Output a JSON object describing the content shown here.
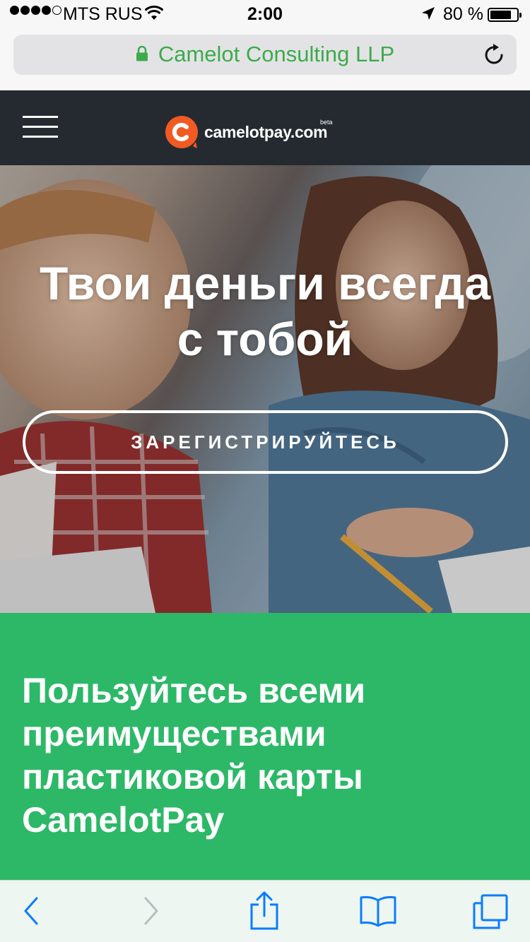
{
  "status_bar": {
    "carrier": "MTS RUS",
    "time": "2:00",
    "battery_percent": "80 %",
    "battery_level": 0.8,
    "signal_bars_filled": 4,
    "signal_bars_total": 5
  },
  "browser": {
    "url_display": "Camelot Consulting LLP",
    "url_color": "#3cab4c"
  },
  "site_header": {
    "logo_text": "camelotpay.com",
    "logo_badge": "beta",
    "brand_color": "#f15a22"
  },
  "hero": {
    "title_line1": "Твои деньги всегда",
    "title_line2": "с тобой",
    "register_button": "ЗАРЕГИСТРИРУЙТЕСЬ"
  },
  "benefits": {
    "title": "Пользуйтесь всеми преимуществами пластиковой карты CamelotPay",
    "background": "#2cb867"
  },
  "toolbar": {
    "icons": [
      "back-icon",
      "forward-icon",
      "share-icon",
      "bookmarks-icon",
      "tabs-icon"
    ],
    "accent": "#0a7cff"
  }
}
